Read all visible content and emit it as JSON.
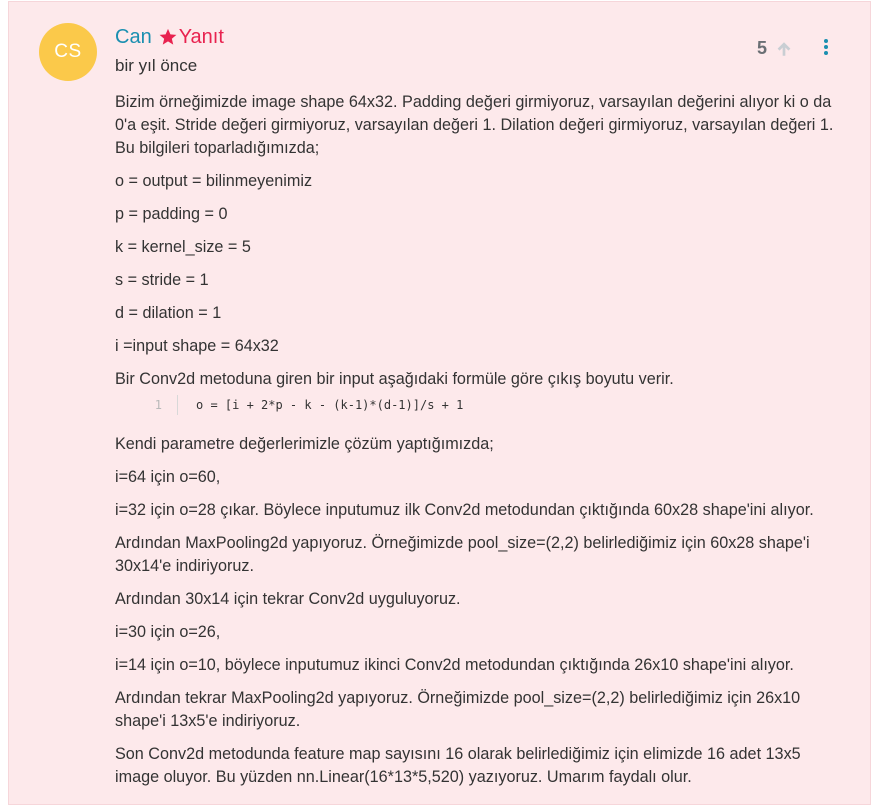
{
  "author": {
    "initials": "CS",
    "name": "Can",
    "role": "Yanıt",
    "timestamp": "bir yıl önce"
  },
  "votes": {
    "count": "5"
  },
  "icons": {
    "star": "star-icon",
    "upvote": "arrow-up-icon",
    "menu": "vertical-dots-icon"
  },
  "colors": {
    "avatar_bg": "#fbc94a",
    "author_name": "#1a8fb0",
    "role": "#e8224f",
    "post_bg": "#fde9eb"
  },
  "body": {
    "paragraphs_before_code": [
      "Bizim örneğimizde image shape 64x32. Padding değeri girmiyoruz, varsayılan değerini alıyor ki o da 0'a eşit. Stride değeri girmiyoruz, varsayılan değeri 1. Dilation değeri girmiyoruz, varsayılan değeri 1. Bu bilgileri toparladığımızda;",
      "o = output = bilinmeyenimiz",
      "p = padding = 0",
      "k = kernel_size = 5",
      "s = stride = 1",
      "d = dilation = 1",
      "i =input shape = 64x32",
      "Bir Conv2d metoduna giren bir input aşağıdaki formüle göre çıkış boyutu verir."
    ],
    "code": {
      "line_number": "1",
      "text": "o = [i + 2*p - k - (k-1)*(d-1)]/s + 1"
    },
    "paragraphs_after_code": [
      "Kendi parametre değerlerimizle çözüm yaptığımızda;",
      "i=64 için o=60,",
      "i=32 için o=28 çıkar. Böylece inputumuz ilk Conv2d metodundan çıktığında 60x28 shape'ini alıyor.",
      "Ardından MaxPooling2d yapıyoruz. Örneğimizde pool_size=(2,2) belirlediğimiz için 60x28 shape'i 30x14'e indiriyoruz.",
      "Ardından 30x14 için tekrar Conv2d uyguluyoruz.",
      "i=30 için o=26,",
      "i=14 için o=10, böylece inputumuz ikinci Conv2d metodundan çıktığında 26x10 shape'ini alıyor.",
      "Ardından tekrar MaxPooling2d yapıyoruz. Örneğimizde pool_size=(2,2) belirlediğimiz için 26x10 shape'i 13x5'e indiriyoruz.",
      "Son Conv2d metodunda feature map sayısını 16 olarak belirlediğimiz için elimizde 16 adet 13x5 image oluyor. Bu yüzden nn.Linear(16*13*5,520) yazıyoruz. Umarım faydalı olur."
    ]
  }
}
